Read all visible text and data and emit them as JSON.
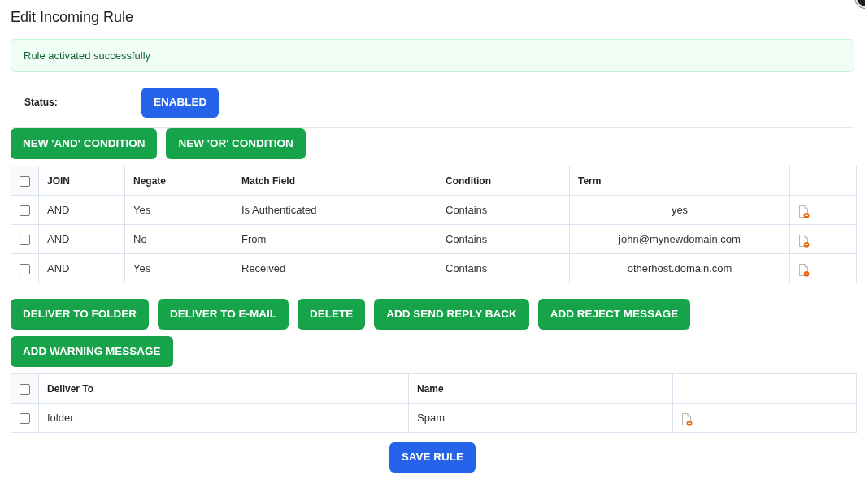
{
  "title": "Edit Incoming Rule",
  "alert": {
    "message": "Rule activated successfully"
  },
  "status": {
    "label": "Status:",
    "button": "ENABLED"
  },
  "condition_buttons": [
    "NEW 'AND' CONDITION",
    "NEW 'OR' CONDITION"
  ],
  "conditions_table": {
    "select_all_checked": false,
    "columns": [
      "JOIN",
      "Negate",
      "Match Field",
      "Condition",
      "Term"
    ],
    "rows": [
      {
        "checked": false,
        "cells": [
          "AND",
          "Yes",
          "Is Authenticated",
          "Contains",
          "yes"
        ]
      },
      {
        "checked": false,
        "cells": [
          "AND",
          "No",
          "From",
          "Contains",
          "john@mynewdomain.com"
        ]
      },
      {
        "checked": false,
        "cells": [
          "AND",
          "Yes",
          "Received",
          "Contains",
          "otherhost.domain.com"
        ]
      }
    ]
  },
  "action_buttons": [
    "DELIVER TO FOLDER",
    "DELIVER TO E-MAIL",
    "DELETE",
    "ADD SEND REPLY BACK",
    "ADD REJECT MESSAGE",
    "ADD WARNING MESSAGE"
  ],
  "actions_table": {
    "select_all_checked": false,
    "columns": [
      "Deliver To",
      "Name"
    ],
    "rows": [
      {
        "checked": false,
        "cells": [
          "folder",
          "Spam"
        ]
      }
    ]
  },
  "save_button": "SAVE RULE"
}
